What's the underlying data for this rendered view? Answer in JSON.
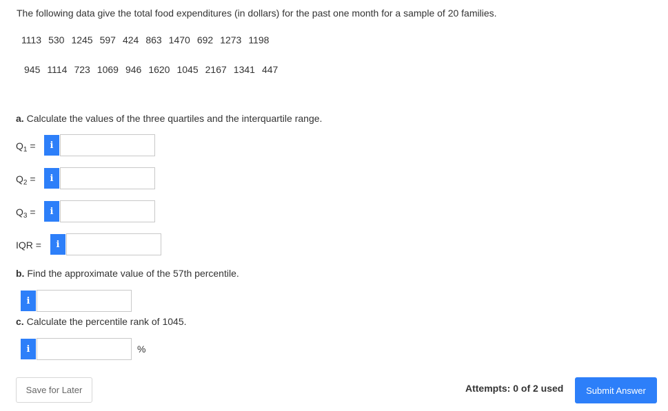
{
  "intro": "The following data give the total food expenditures (in dollars) for the past one month for a sample of 20 families.",
  "data_row_1": [
    "1113",
    "530",
    "1245",
    "597",
    "424",
    "863",
    "1470",
    "692",
    "1273",
    "1198"
  ],
  "data_row_2": [
    "945",
    "1114",
    "723",
    "1069",
    "946",
    "1620",
    "1045",
    "2167",
    "1341",
    "447"
  ],
  "part_a": {
    "prefix": "a.",
    "text": " Calculate the values of the three quartiles and the interquartile range.",
    "q1_letter": "Q",
    "q1_sub": "1",
    "q2_letter": "Q",
    "q2_sub": "2",
    "q3_letter": "Q",
    "q3_sub": "3",
    "eq": " =",
    "iqr_label": "IQR =",
    "q1_value": "",
    "q2_value": "",
    "q3_value": "",
    "iqr_value": ""
  },
  "part_b": {
    "prefix": "b.",
    "text": " Find the approximate value of the 57th percentile.",
    "value": ""
  },
  "part_c": {
    "prefix": "c.",
    "text": " Calculate the percentile rank of 1045.",
    "value": "",
    "unit": "%"
  },
  "info_glyph": "i",
  "footer": {
    "save_label": "Save for Later",
    "attempts": "Attempts: 0 of 2 used",
    "submit_label": "Submit Answer"
  },
  "colors": {
    "accent": "#2d7ff9",
    "text": "#333333",
    "border": "#c8c8c8"
  }
}
